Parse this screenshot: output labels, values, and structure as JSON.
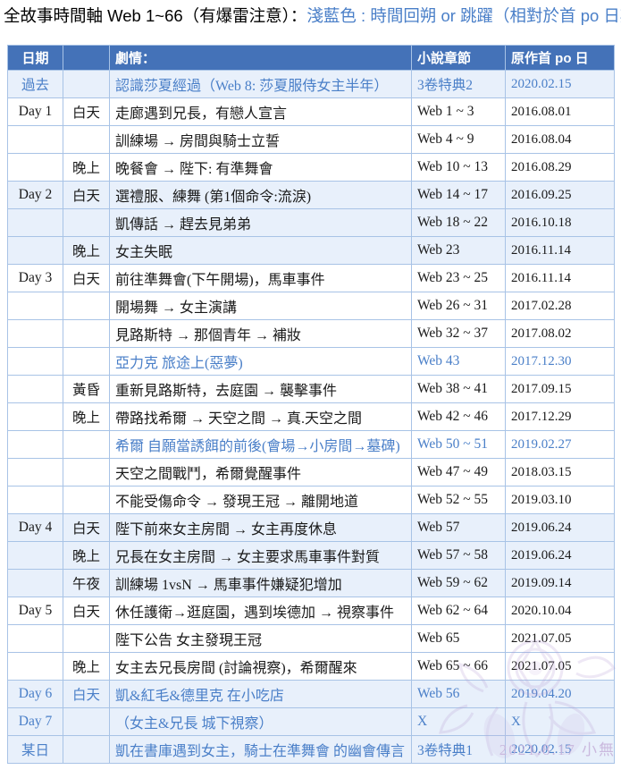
{
  "title": {
    "main": "全故事時間軸 Web 1~66（有爆雷注意）：",
    "accent": "淺藍色 : 時間回朔 or 跳躍（相對於首 po 日期）"
  },
  "legend": {
    "accent_color": "#4a7fc8",
    "header_color": "#4472b8",
    "band_color": "#e8f0fb"
  },
  "watermark": {
    "text": "2021.8.17 小無"
  },
  "table": {
    "headers": [
      "日期",
      "",
      "劇情：",
      "小說章節",
      "原作首 po 日"
    ],
    "rows": [
      {
        "date": "過去",
        "time": "",
        "plot": "認識莎夏經過（Web 8: 莎夏服侍女主半年）",
        "chapter": "3卷特典2",
        "pub": "2020.02.15",
        "band": true,
        "blue": true
      },
      {
        "date": "Day 1",
        "time": "白天",
        "plot": "走廊遇到兄長，有戀人宣言",
        "chapter": "Web 1 ~ 3",
        "pub": "2016.08.01",
        "band": false,
        "blue": false
      },
      {
        "date": "",
        "time": "",
        "plot": "訓練場 → 房間與騎士立誓",
        "chapter": "Web 4 ~ 9",
        "pub": "2016.08.04",
        "band": false,
        "blue": false
      },
      {
        "date": "",
        "time": "晚上",
        "plot": "晚餐會 → 陛下: 有準舞會",
        "chapter": "Web 10 ~ 13",
        "pub": "2016.08.29",
        "band": false,
        "blue": false
      },
      {
        "date": "Day 2",
        "time": "白天",
        "plot": "選禮服、練舞 (第1個命令:流淚)",
        "chapter": "Web 14 ~ 17",
        "pub": "2016.09.25",
        "band": true,
        "blue": false
      },
      {
        "date": "",
        "time": "",
        "plot": "凱傳話 → 趕去見弟弟",
        "chapter": "Web 18 ~ 22",
        "pub": "2016.10.18",
        "band": true,
        "blue": false
      },
      {
        "date": "",
        "time": "晚上",
        "plot": "女主失眠",
        "chapter": "Web 23",
        "pub": "2016.11.14",
        "band": true,
        "blue": false
      },
      {
        "date": "Day 3",
        "time": "白天",
        "plot": "前往準舞會(下午開場)，馬車事件",
        "chapter": "Web 23 ~ 25",
        "pub": "2016.11.14",
        "band": false,
        "blue": false
      },
      {
        "date": "",
        "time": "",
        "plot": "開場舞 → 女主演講",
        "chapter": "Web 26 ~ 31",
        "pub": "2017.02.28",
        "band": false,
        "blue": false
      },
      {
        "date": "",
        "time": "",
        "plot": "見路斯特 → 那個青年 → 補妝",
        "chapter": "Web 32 ~ 37",
        "pub": "2017.08.02",
        "band": false,
        "blue": false
      },
      {
        "date": "",
        "time": "",
        "plot": "亞力克 旅途上(惡夢)",
        "chapter": "Web 43",
        "pub": "2017.12.30",
        "band": false,
        "blue": true
      },
      {
        "date": "",
        "time": "黃昏",
        "plot": "重新見路斯特，去庭園 → 襲擊事件",
        "chapter": "Web 38 ~ 41",
        "pub": "2017.09.15",
        "band": false,
        "blue": false
      },
      {
        "date": "",
        "time": "晚上",
        "plot": "帶路找希爾 → 天空之間 → 真.天空之間",
        "chapter": "Web 42 ~ 46",
        "pub": "2017.12.29",
        "band": false,
        "blue": false
      },
      {
        "date": "",
        "time": "",
        "plot": "希爾 自願當誘餌的前後(會場→小房間→墓碑)",
        "chapter": "Web 50 ~ 51",
        "pub": "2019.02.27",
        "band": false,
        "blue": true
      },
      {
        "date": "",
        "time": "",
        "plot": "天空之間戰鬥，希爾覺醒事件",
        "chapter": "Web 47 ~ 49",
        "pub": "2018.03.15",
        "band": false,
        "blue": false
      },
      {
        "date": "",
        "time": "",
        "plot": "不能受傷命令 → 發現王冠 → 離開地道",
        "chapter": "Web 52 ~ 55",
        "pub": "2019.03.10",
        "band": false,
        "blue": false
      },
      {
        "date": "Day 4",
        "time": "白天",
        "plot": "陛下前來女主房間 → 女主再度休息",
        "chapter": "Web 57",
        "pub": "2019.06.24",
        "band": true,
        "blue": false
      },
      {
        "date": "",
        "time": "晚上",
        "plot": "兄長在女主房間 → 女主要求馬車事件對質",
        "chapter": "Web 57 ~ 58",
        "pub": "2019.06.24",
        "band": true,
        "blue": false
      },
      {
        "date": "",
        "time": "午夜",
        "plot": "訓練場 1vsN → 馬車事件嫌疑犯增加",
        "chapter": "Web 59 ~ 62",
        "pub": "2019.09.14",
        "band": true,
        "blue": false
      },
      {
        "date": "Day 5",
        "time": "白天",
        "plot": "休任護衛→逛庭園，遇到埃德加 → 視察事件",
        "chapter": "Web 62 ~ 64",
        "pub": "2020.10.04",
        "band": false,
        "blue": false
      },
      {
        "date": "",
        "time": "",
        "plot": "陛下公告 女主發現王冠",
        "chapter": "Web 65",
        "pub": "2021.07.05",
        "band": false,
        "blue": false
      },
      {
        "date": "",
        "time": "晚上",
        "plot": "女主去兄長房間 (討論視察)，希爾醒來",
        "chapter": "Web 65 ~ 66",
        "pub": "2021.07.05",
        "band": false,
        "blue": false
      },
      {
        "date": "Day 6",
        "time": "白天",
        "plot": "凱&紅毛&德里克 在小吃店",
        "chapter": "Web 56",
        "pub": "2019.04.20",
        "band": true,
        "blue": true
      },
      {
        "date": "Day 7",
        "time": "",
        "plot": "（女主&兄長 城下視察）",
        "chapter": "X",
        "pub": "X",
        "band": true,
        "blue": true
      },
      {
        "date": "某日",
        "time": "",
        "plot": "凱在書庫遇到女主，騎士在準舞會 的幽會傳言",
        "chapter": "3卷特典1",
        "pub": "2020.02.15",
        "band": true,
        "blue": true
      }
    ]
  }
}
